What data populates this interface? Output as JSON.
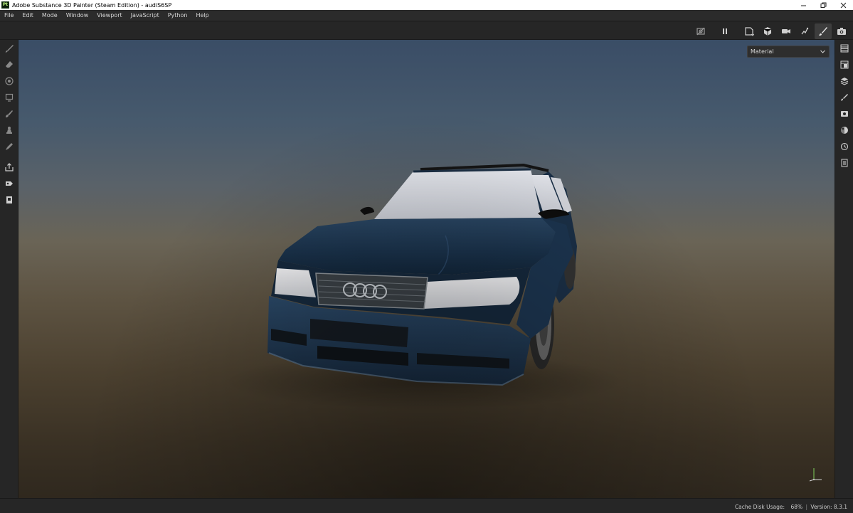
{
  "window": {
    "title": "Adobe Substance 3D Painter (Steam Edition) - audiS6SP",
    "logo_text": "Pt"
  },
  "menu": [
    "File",
    "Edit",
    "Mode",
    "Window",
    "Viewport",
    "JavaScript",
    "Python",
    "Help"
  ],
  "toolbar": {
    "icons": [
      "hide-mesh-icon",
      "pause-icon",
      "display-settings-icon",
      "shader-settings-icon",
      "camera-icon",
      "symmetry-icon",
      "paint-brush-icon",
      "screenshot-icon"
    ],
    "active": "paint-brush-icon"
  },
  "left_tools": [
    "paint-icon",
    "eraser-icon",
    "projection-icon",
    "polygon-fill-icon",
    "smudge-icon",
    "clone-icon",
    "color-picker-icon",
    "export-icon",
    "bake-icon",
    "document-icon"
  ],
  "right_tools": [
    "layers-panel-icon",
    "texture-set-icon",
    "stack-icon",
    "brush-properties-icon",
    "display-icon",
    "shader-icon",
    "history-icon",
    "log-icon"
  ],
  "viewport": {
    "channel_select": "Material"
  },
  "status": {
    "cache_label": "Cache Disk Usage:",
    "cache_value": "68%",
    "separator": "|",
    "version": "Version: 8.3.1"
  },
  "colors": {
    "car_paint": "#1d3a55",
    "panel_bg": "#262626",
    "sky_top": "#3a4d66",
    "ground": "#4c4130"
  }
}
